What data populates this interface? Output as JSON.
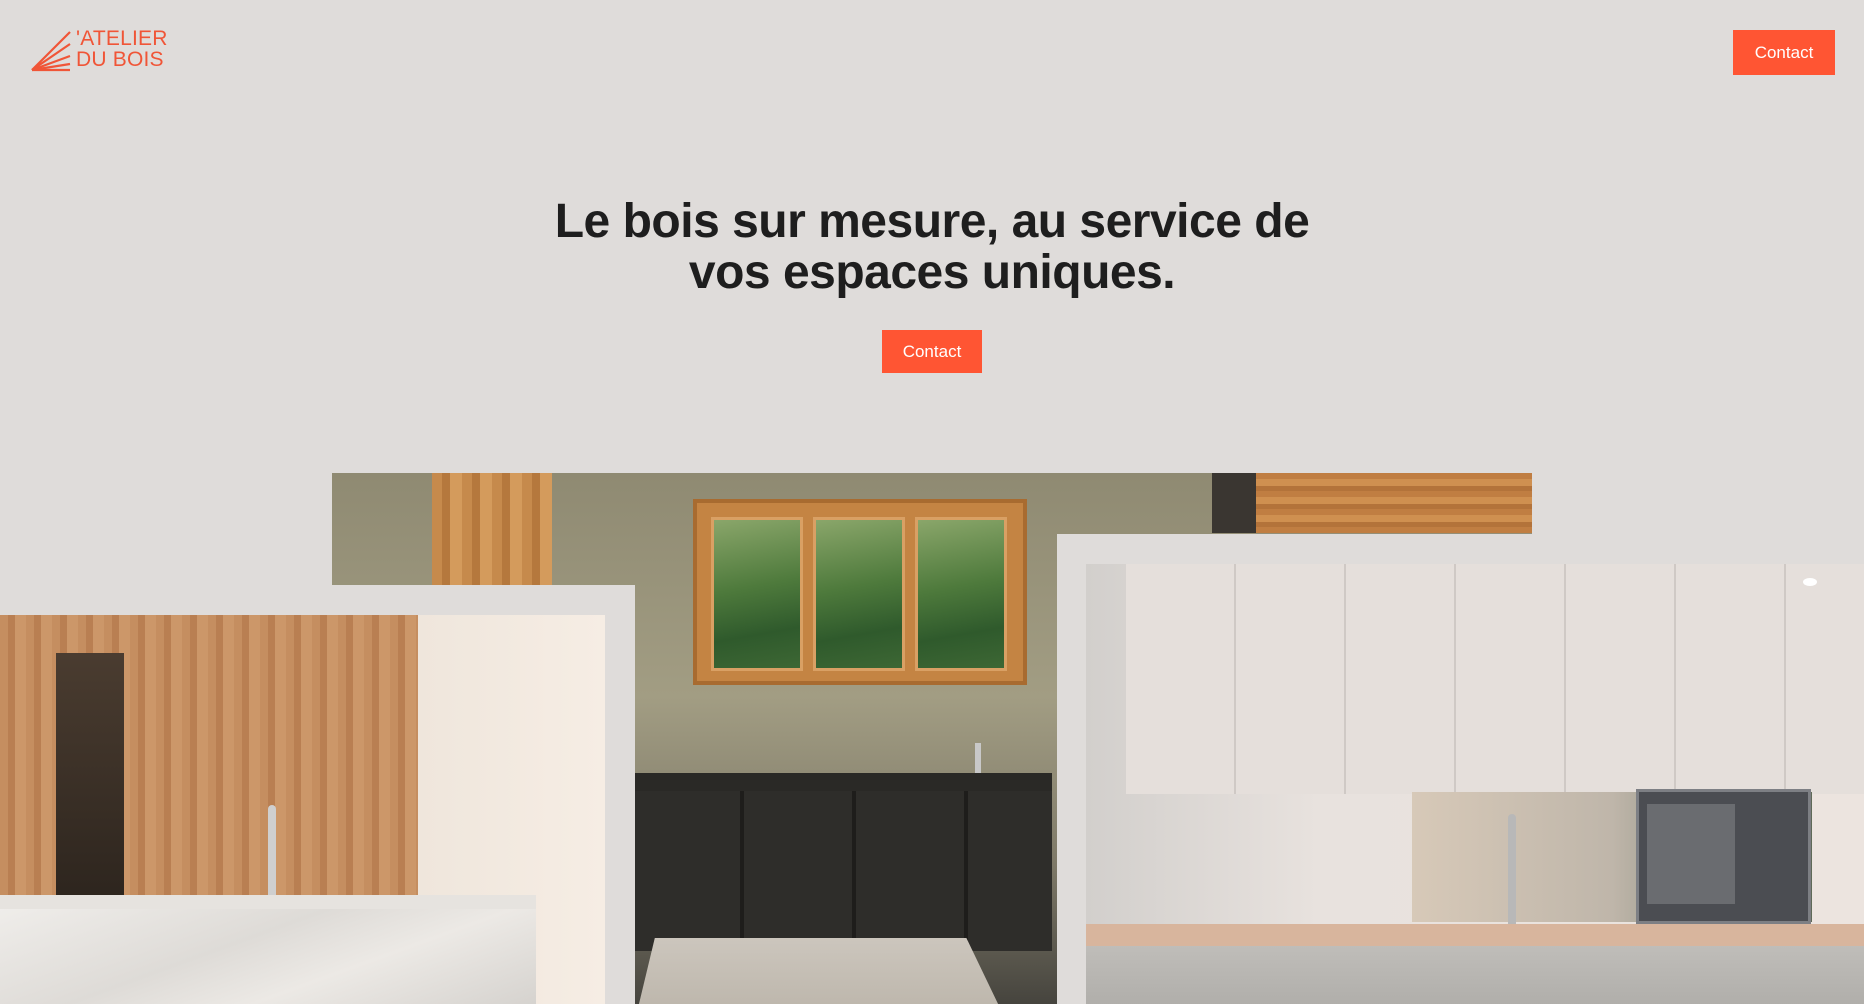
{
  "header": {
    "logo_line1": "'ATELIER",
    "logo_line2": "DU BOIS",
    "contact_label": "Contact"
  },
  "hero": {
    "title_line1": "Le bois sur mesure, au service de",
    "title_line2": "vos espaces uniques.",
    "contact_label": "Contact"
  },
  "colors": {
    "accent": "#ff5533",
    "logo": "#f05537",
    "background": "#dfdcda",
    "heading": "#1e1e1e"
  },
  "gallery": {
    "images": [
      "kitchen-window-photo",
      "kitchen-marble-island-photo",
      "kitchen-white-cabinets-photo"
    ]
  }
}
